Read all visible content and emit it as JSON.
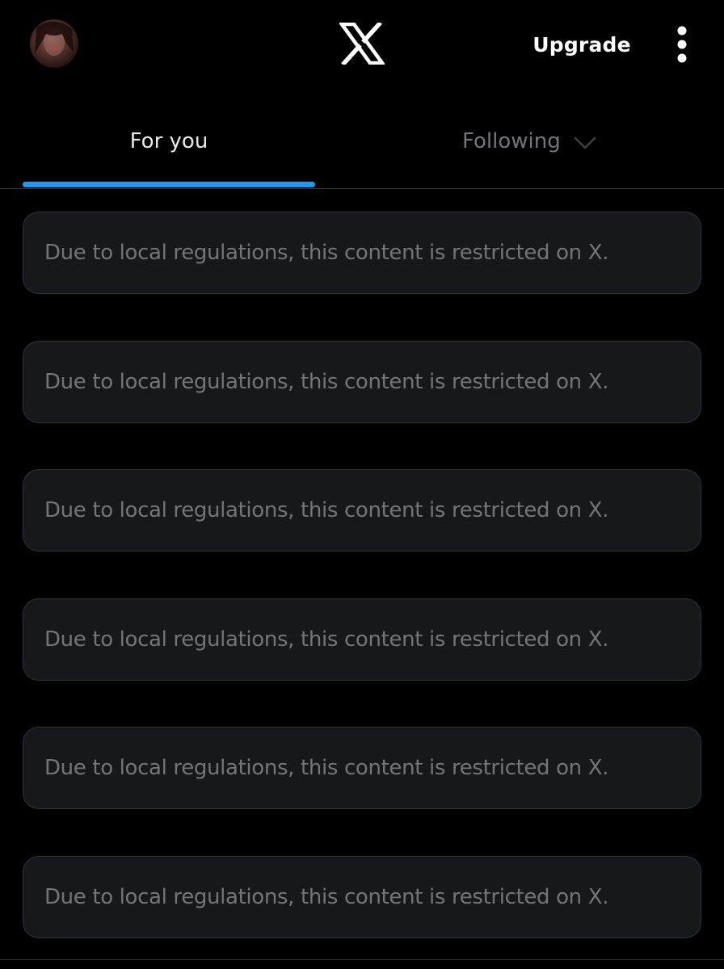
{
  "app": "X",
  "header": {
    "avatar_alt": "profile",
    "logo_icon": "x-logo-icon",
    "upgrade_label": "Upgrade",
    "more_icon": "vertical-ellipsis-icon"
  },
  "tabs": [
    {
      "label": "For you",
      "active": true
    },
    {
      "label": "Following",
      "active": false,
      "icon": "chevron-down-icon"
    }
  ],
  "feed": {
    "items": [
      {
        "text": "Due to local regulations, this content is restricted on X."
      },
      {
        "text": "Due to local regulations, this content is restricted on X."
      },
      {
        "text": "Due to local regulations, this content is restricted on X."
      },
      {
        "text": "Due to local regulations, this content is restricted on X."
      },
      {
        "text": "Due to local regulations, this content is restricted on X."
      },
      {
        "text": "Due to local regulations, this content is restricted on X."
      }
    ]
  },
  "colors": {
    "background": "#000000",
    "accent": "#1d9bf0",
    "card_background": "#16181c",
    "card_border": "#2f3336",
    "muted_text": "#71767b",
    "primary_text": "#e7e9ea"
  }
}
